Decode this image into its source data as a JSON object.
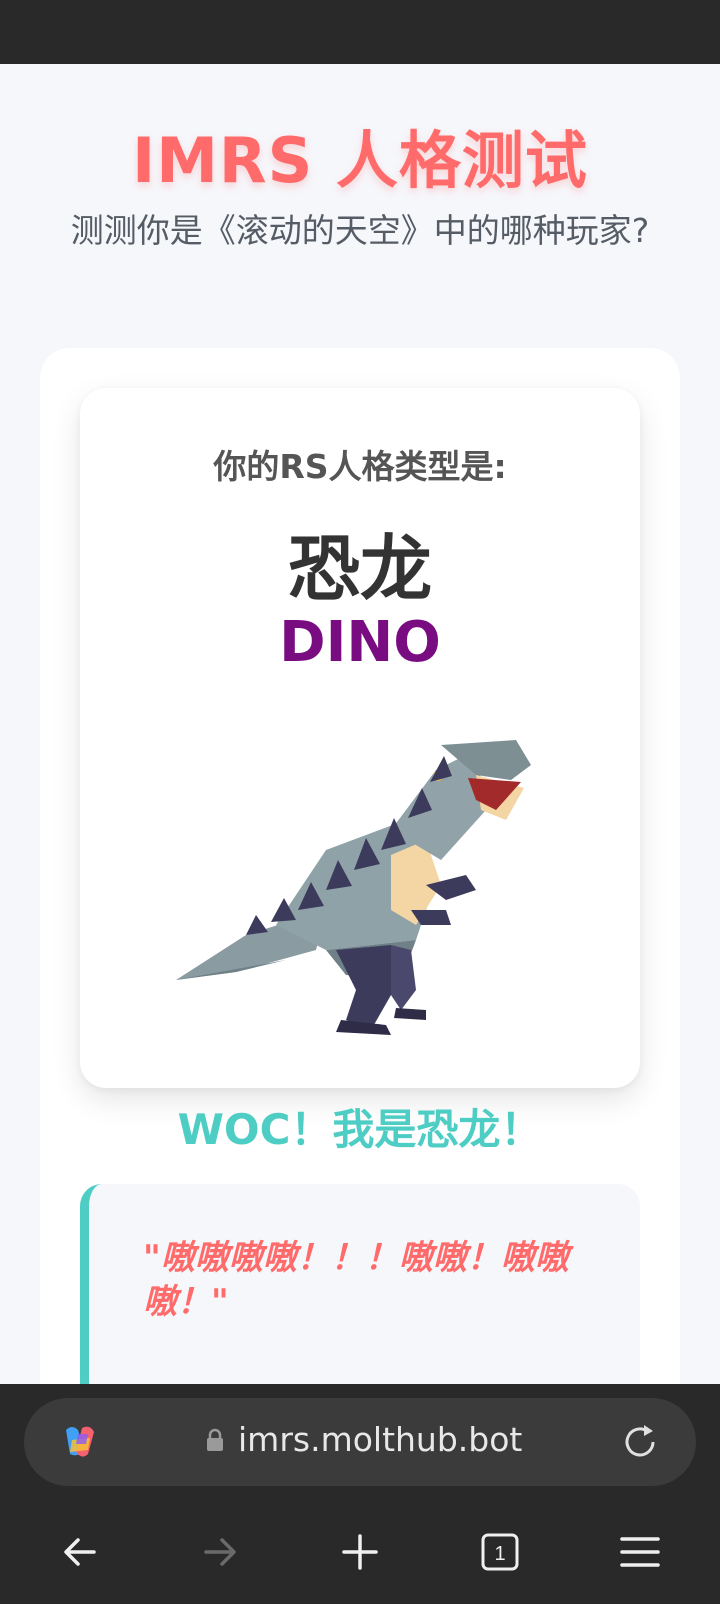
{
  "header": {
    "title": "IMRS 人格测试",
    "subtitle": "测测你是《滚动的天空》中的哪种玩家?"
  },
  "result": {
    "label": "你的RS人格类型是:",
    "name": "恐龙",
    "code": "DINO",
    "image_icon": "dinosaur-illustration"
  },
  "tagline": "WOC！我是恐龙！",
  "quote": "\"嗷嗷嗷嗷！！！嗷嗷！嗷嗷嗷！\"",
  "browser": {
    "url": "imrs.molthub.bot",
    "tab_count": "1",
    "icons": [
      "copilot-icon",
      "lock-icon",
      "reload-icon",
      "back-arrow-icon",
      "forward-arrow-icon",
      "new-tab-icon",
      "tabs-icon",
      "menu-icon"
    ]
  },
  "colors": {
    "title": "#ff6b6b",
    "accent_teal": "#4ecdc4",
    "dino_code": "#7a0c82",
    "chrome_bg": "#292929"
  }
}
